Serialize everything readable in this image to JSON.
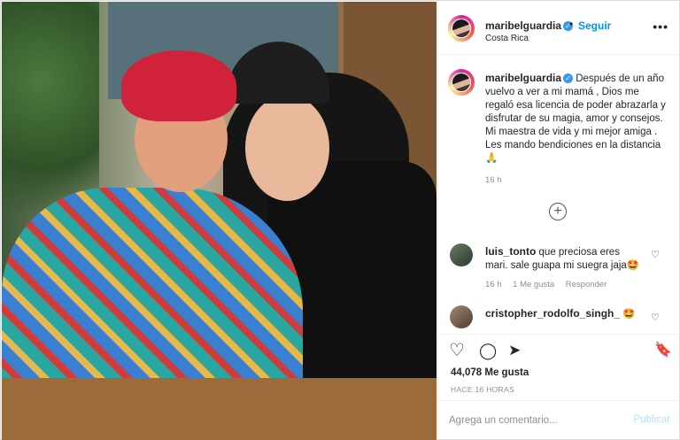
{
  "post": {
    "username": "maribelguardia",
    "follow_label": "Seguir",
    "dot": "•",
    "location": "Costa Rica",
    "more_label": "•••",
    "caption": "Después de un año vuelvo a ver a mi mamá , Dios me regaló esa licencia de poder abrazarla y disfrutar de su magia, amor y consejos. Mi maestra de vida y mi mejor amiga . Les mando bendiciones en la distancia 🙏",
    "caption_time": "16 h",
    "load_more_label": "+",
    "likes": "44,078 Me gusta",
    "posted_ago": "HACE 16 HORAS"
  },
  "comments": [
    {
      "username": "luis_tonto",
      "text": "que preciosa eres mari. sale guapa mi suegra jaja🤩",
      "time": "16 h",
      "likes": "1 Me gusta",
      "reply_label": "Responder"
    },
    {
      "username": "cristopher_rodolfo_singh_",
      "text": "🤩"
    }
  ],
  "icons": {
    "heart": "♡",
    "comment": "◯",
    "share": "➤",
    "save": "🔖",
    "verified": "✓"
  },
  "add_comment": {
    "placeholder": "Agrega un comentario...",
    "publish_label": "Publicar"
  },
  "colors": {
    "link_blue": "#0095f6",
    "verified_blue": "#3897f0",
    "publish_disabled": "#b2dffc",
    "muted": "#8e8e8e"
  }
}
